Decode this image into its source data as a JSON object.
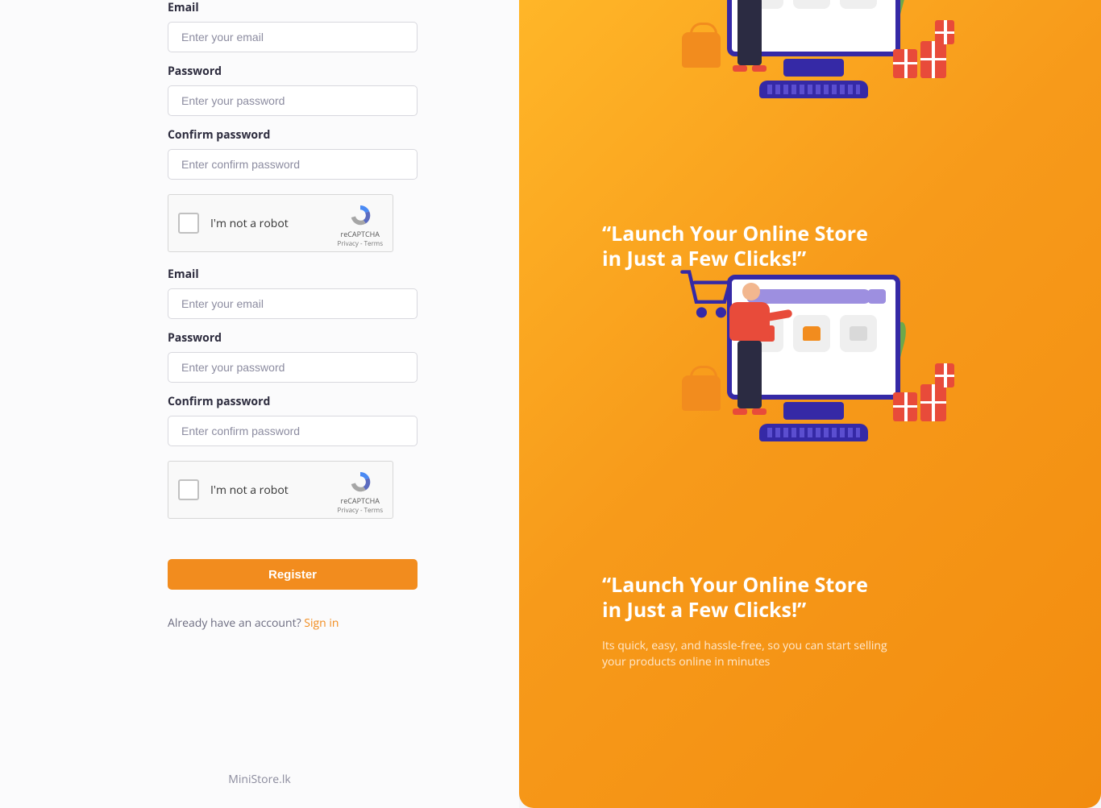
{
  "form": {
    "groups": [
      {
        "email_label": "Email",
        "email_placeholder": "Enter your email",
        "password_label": "Password",
        "password_placeholder": "Enter your password",
        "confirm_label": "Confirm password",
        "confirm_placeholder": "Enter confirm password"
      },
      {
        "email_label": "Email",
        "email_placeholder": "Enter your email",
        "password_label": "Password",
        "password_placeholder": "Enter your password",
        "confirm_label": "Confirm password",
        "confirm_placeholder": "Enter confirm password"
      }
    ],
    "recaptcha": {
      "text": "I'm not a robot",
      "brand": "reCAPTCHA",
      "terms": "Privacy - Terms"
    },
    "submit_label": "Register",
    "already_text": "Already have an account? ",
    "signin_label": "Sign in"
  },
  "footer": {
    "brand": "MiniStore.lk"
  },
  "hero": {
    "tagline": "“Launch Your Online Store in Just a Few Clicks!”",
    "sub": "Its quick, easy, and hassle-free, so you can start selling your products online in minutes"
  }
}
